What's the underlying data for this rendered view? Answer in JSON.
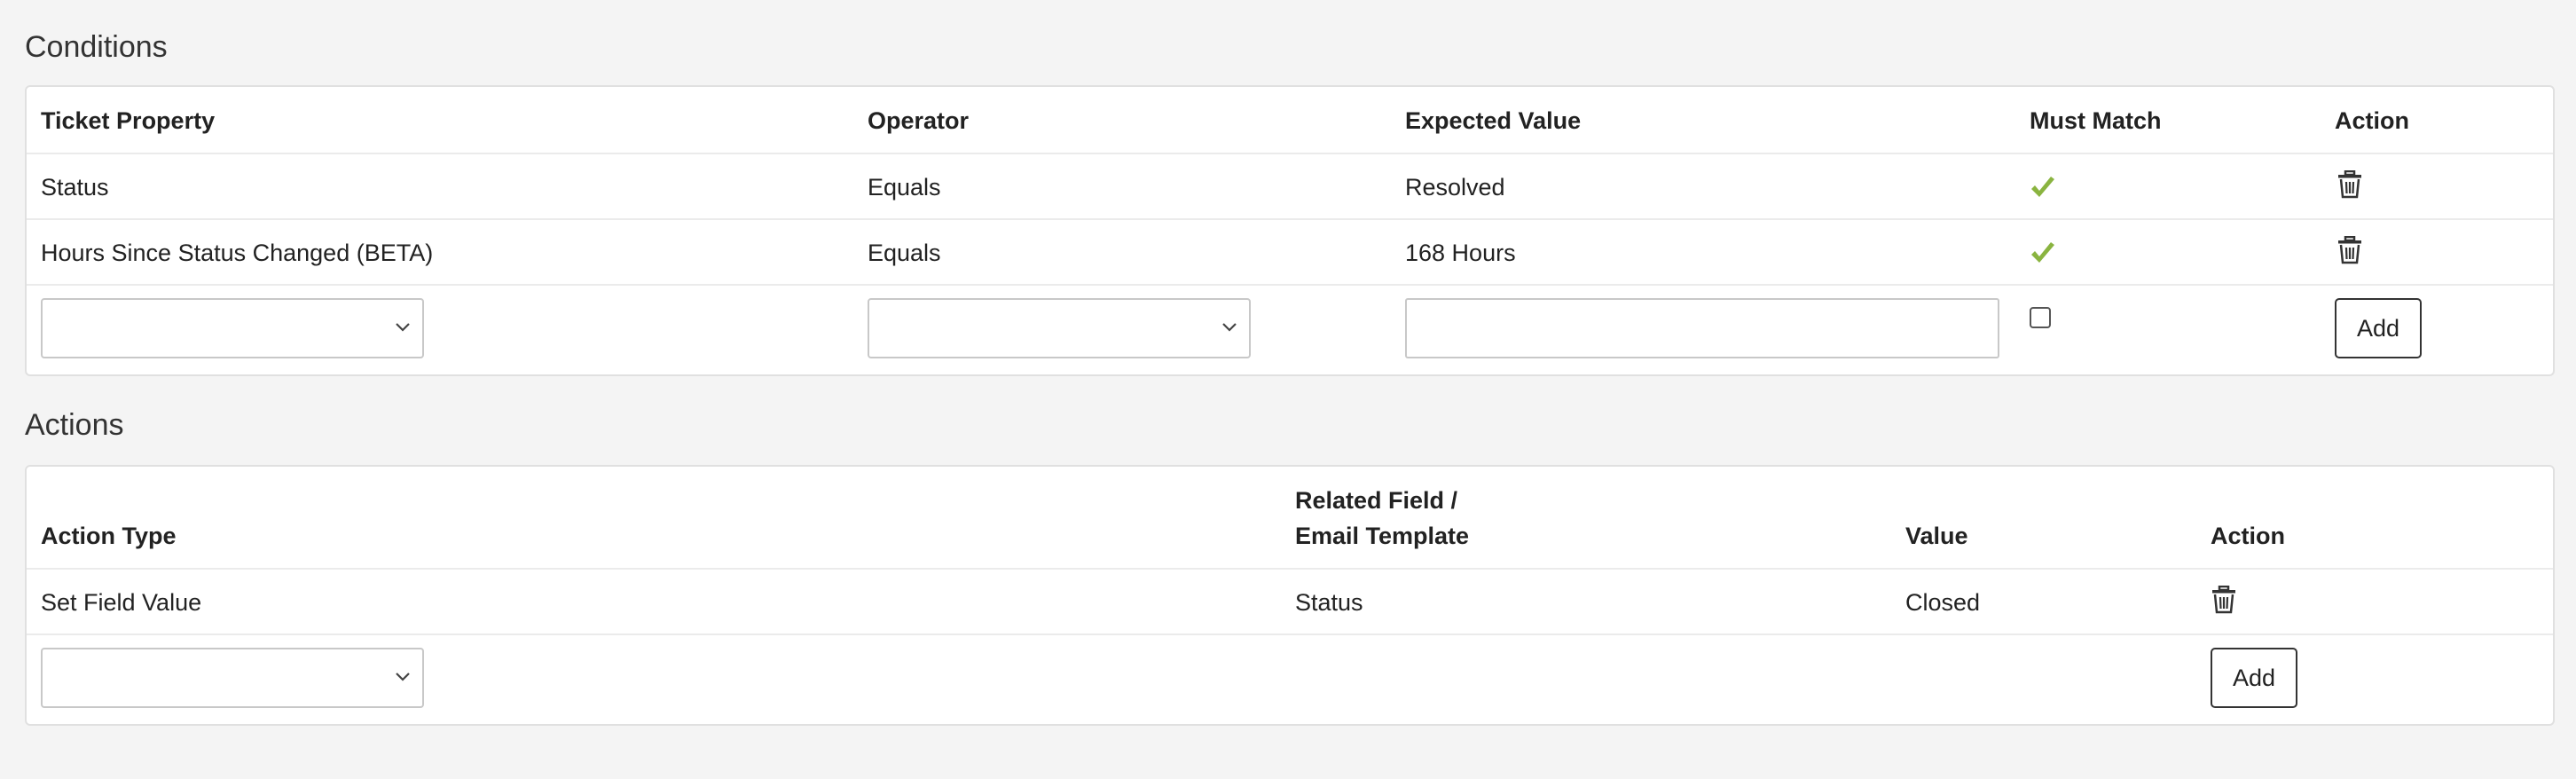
{
  "conditions": {
    "title": "Conditions",
    "headers": {
      "property": "Ticket Property",
      "operator": "Operator",
      "expected": "Expected Value",
      "must_match": "Must Match",
      "action": "Action"
    },
    "rows": [
      {
        "property": "Status",
        "operator": "Equals",
        "expected": "Resolved",
        "must_match": "check-icon",
        "action": "trash-icon"
      },
      {
        "property": "Hours Since Status Changed (BETA)",
        "operator": "Equals",
        "expected": "168 Hours",
        "must_match": "check-icon",
        "action": "trash-icon"
      }
    ],
    "new_row": {
      "property_value": "",
      "operator_value": "",
      "expected_value": "",
      "must_match_checked": false,
      "add_label": "Add"
    }
  },
  "actions": {
    "title": "Actions",
    "headers": {
      "type": "Action Type",
      "related_line1": "Related Field /",
      "related_line2": "Email Template",
      "value": "Value",
      "action": "Action"
    },
    "rows": [
      {
        "type": "Set Field Value",
        "related": "Status",
        "value": "Closed",
        "action": "trash-icon"
      }
    ],
    "new_row": {
      "type_value": "",
      "add_label": "Add"
    }
  },
  "colors": {
    "check": "#8ab440",
    "text": "#222222",
    "background": "#f4f4f4"
  }
}
